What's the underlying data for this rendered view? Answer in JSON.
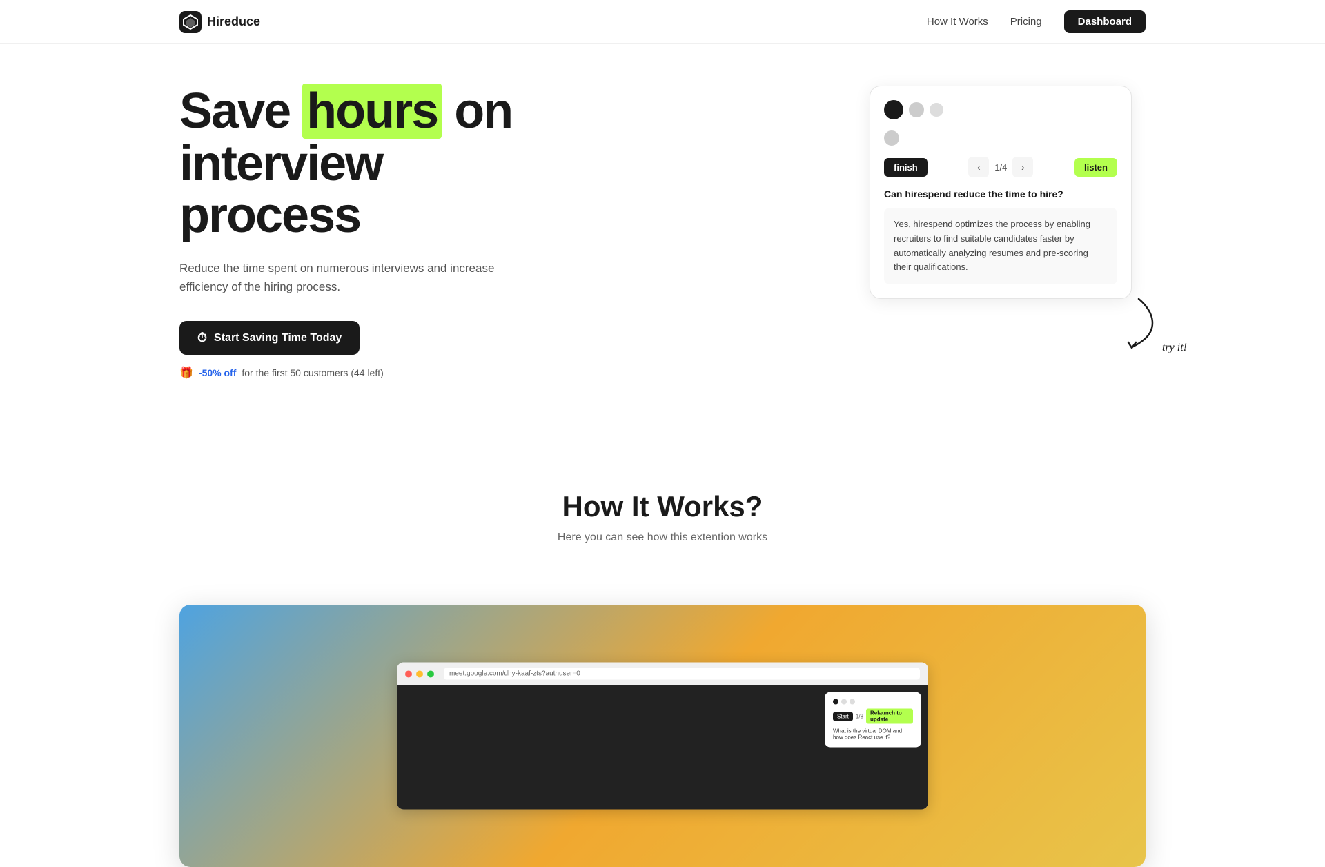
{
  "nav": {
    "logo_text": "Hireduce",
    "links": [
      {
        "label": "How It Works",
        "href": "#"
      },
      {
        "label": "Pricing",
        "href": "#"
      }
    ],
    "dashboard_label": "Dashboard"
  },
  "hero": {
    "title_part1": "Save ",
    "title_highlight": "hours",
    "title_part2": " on interview process",
    "subtitle": "Reduce the time spent on numerous interviews and increase efficiency of the hiring process.",
    "cta_label": "Start Saving Time Today",
    "discount_text": "-50% off",
    "discount_suffix": "for the first 50 customers (44 left)"
  },
  "qa_card": {
    "page_current": "1",
    "page_total": "4",
    "finish_label": "finish",
    "listen_label": "listen",
    "question": "Can hirespend reduce the time to hire?",
    "answer": "Yes, hirespend optimizes the process by enabling recruiters to find suitable candidates faster by automatically analyzing resumes and pre-scoring their qualifications."
  },
  "try_it": {
    "label": "try it!"
  },
  "how_it_works": {
    "title": "How It Works?",
    "subtitle": "Here you can see how this extention works"
  },
  "browser": {
    "url": "meet.google.com/dhy-kaaf-zts?authuser=0",
    "overlay": {
      "page_label": "1/8",
      "start_btn": "Start",
      "update_btn": "Relaunch to update",
      "question": "What is the virtual DOM and how does React use it?"
    }
  }
}
